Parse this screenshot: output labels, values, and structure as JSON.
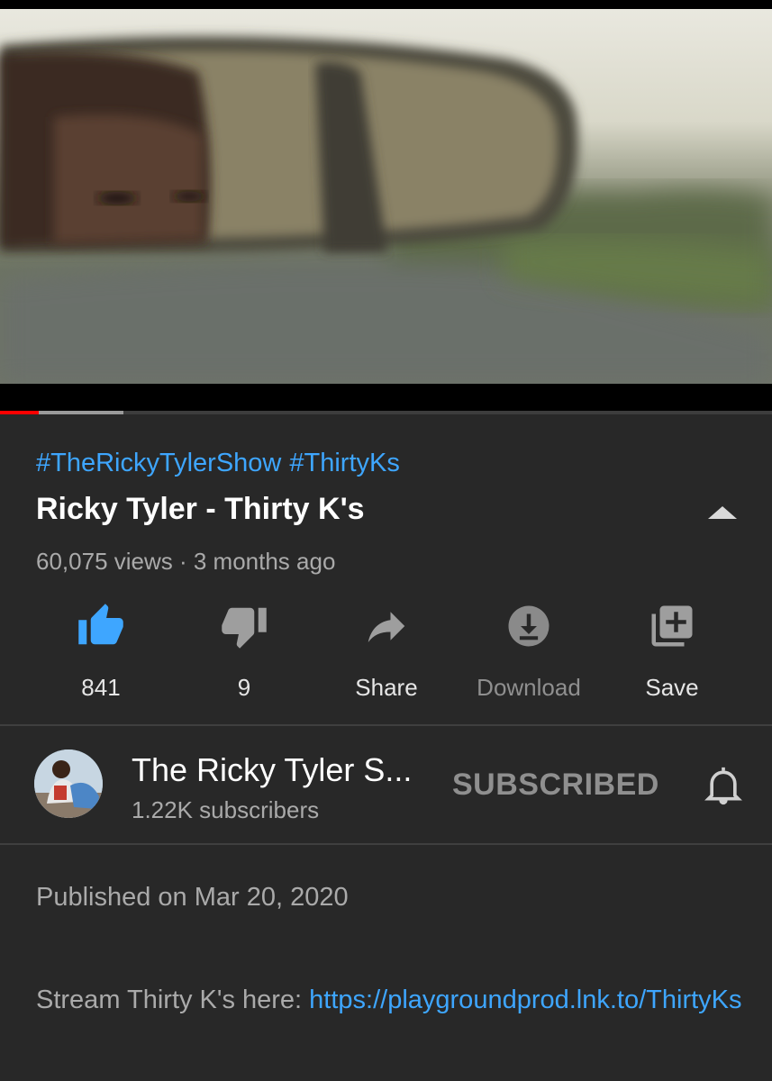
{
  "player": {
    "progress_played": 0.05,
    "progress_buffered": 0.16
  },
  "video": {
    "hashtags": [
      "#TheRickyTylerShow",
      "#ThirtyKs"
    ],
    "title": "Ricky Tyler - Thirty K's",
    "meta": "60,075 views · 3 months ago"
  },
  "actions": {
    "like_count": "841",
    "dislike_count": "9",
    "share_label": "Share",
    "download_label": "Download",
    "save_label": "Save"
  },
  "channel": {
    "name": "The Ricky Tyler S...",
    "subscribers": "1.22K subscribers",
    "subscribe_state": "SUBSCRIBED"
  },
  "description": {
    "published": "Published on Mar 20, 2020",
    "text_prefix": "Stream Thirty K's here: ",
    "link": "https://playgroundprod.lnk.to/ThirtyKs"
  },
  "colors": {
    "background": "#282828",
    "link": "#3ea6ff",
    "like_active": "#3ea6ff",
    "progress": "#ff0000"
  },
  "icons": [
    "thumb-up-icon",
    "thumb-down-icon",
    "share-arrow-icon",
    "download-icon",
    "playlist-add-icon",
    "bell-icon",
    "collapse-triangle-icon"
  ]
}
